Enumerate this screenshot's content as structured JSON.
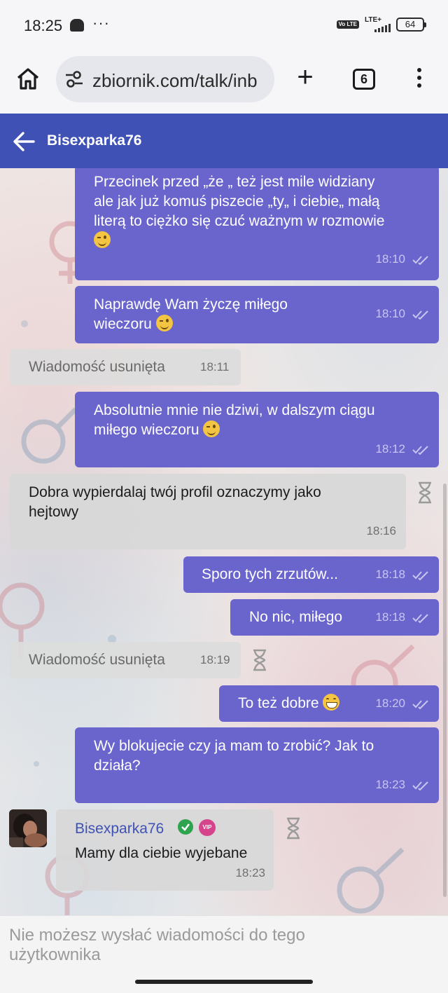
{
  "status_bar": {
    "time": "18:25",
    "dots": "···",
    "volte": "Vo LTE",
    "network": "LTE+",
    "battery": "64"
  },
  "browser": {
    "url": "zbiornik.com/talk/inb",
    "tab_count": "6",
    "plus": "+"
  },
  "header": {
    "title": "Bisexparka76"
  },
  "messages": [
    {
      "lines": [
        "Przecinek przed „że „ też jest mile widziany",
        "ale jak już komuś piszecie „ty„ i ciebie„ małą",
        "literą to ciężko się czuć ważnym w rozmowie"
      ],
      "emoji": "wink",
      "time": "18:10"
    },
    {
      "lines": [
        "Naprawdę Wam życzę miłego",
        "wieczoru"
      ],
      "emoji": "wink",
      "time": "18:10"
    },
    {
      "text": "Wiadomość usunięta",
      "time": "18:11"
    },
    {
      "lines": [
        "Absolutnie mnie nie dziwi, w dalszym ciągu",
        "miłego wieczoru"
      ],
      "emoji": "wink",
      "time": "18:12"
    },
    {
      "lines": [
        "Dobra wypierdalaj twój profil oznaczymy jako",
        "hejtowy"
      ],
      "time": "18:16"
    },
    {
      "text": "Sporo tych zrzutów...",
      "time": "18:18"
    },
    {
      "text": "No nic, miłego",
      "time": "18:18"
    },
    {
      "text": "Wiadomość usunięta",
      "time": "18:19"
    },
    {
      "text": "To też dobre",
      "emoji": "grin",
      "time": "18:20"
    },
    {
      "lines": [
        "Wy blokujecie czy ja mam to zrobić? Jak to",
        "działa?"
      ],
      "time": "18:23"
    },
    {
      "sender": "Bisexparka76",
      "badge": "VIP",
      "text": "Mamy dla ciebie wyjebane",
      "time": "18:23"
    }
  ],
  "composer": {
    "notice": "Nie możesz wysłać wiadomości do tego użytkownika"
  },
  "colors": {
    "header": "#3f51b5",
    "outgoing_bubble": "#6a64cd",
    "incoming_bubble": "#d8d8d8",
    "sender_name": "#3f51b5"
  }
}
